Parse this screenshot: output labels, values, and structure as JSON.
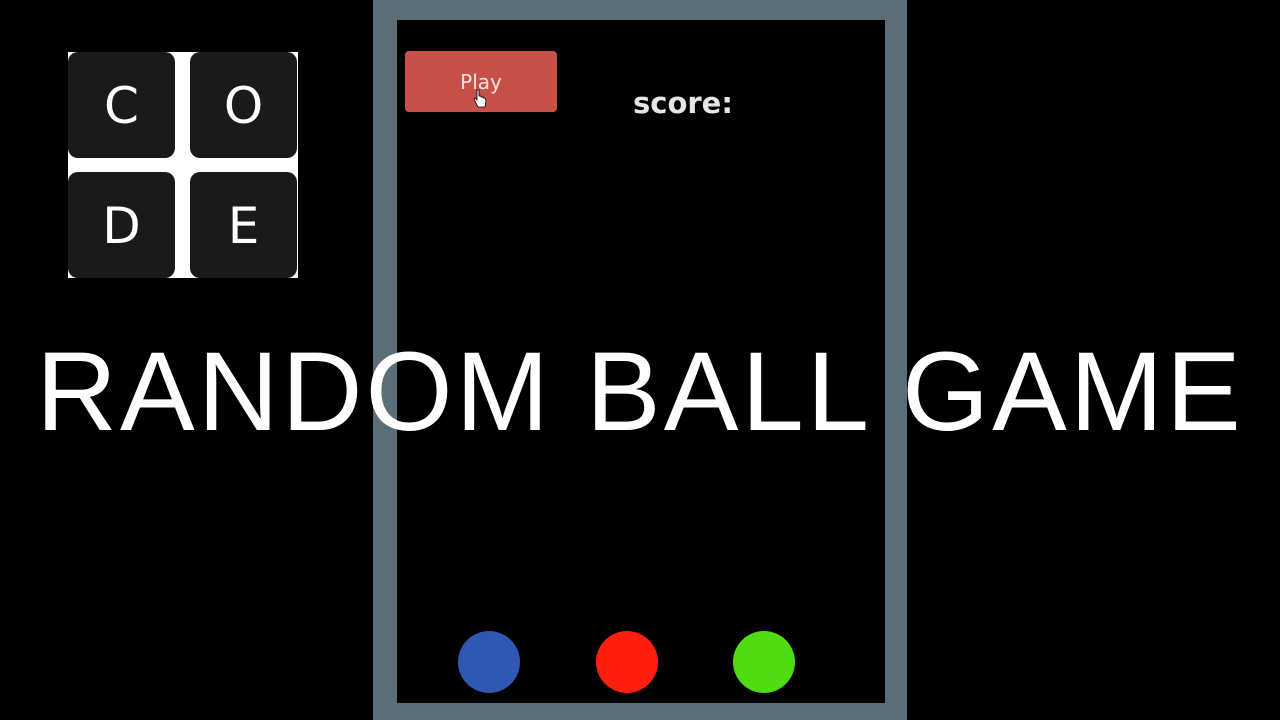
{
  "logo": {
    "letters": [
      "C",
      "O",
      "D",
      "E"
    ]
  },
  "game": {
    "play_label": "Play",
    "score_label": "score:",
    "balls": [
      {
        "name": "blue",
        "color": "#2f57b3"
      },
      {
        "name": "red",
        "color": "#ff1f10"
      },
      {
        "name": "green",
        "color": "#4fdc12"
      }
    ],
    "colors": {
      "frame": "#5b6e77",
      "canvas": "#000000",
      "play_button": "#c75148"
    }
  },
  "title": "RANDOM BALL GAME"
}
